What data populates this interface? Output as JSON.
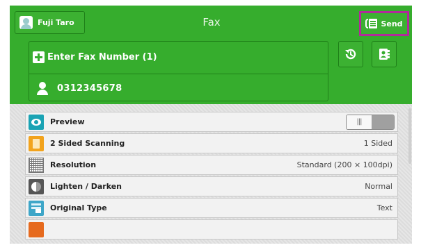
{
  "header": {
    "user_name": "Fuji Taro",
    "title": "Fax",
    "send_label": "Send"
  },
  "fax": {
    "enter_label": "Enter Fax Number (1)",
    "recipient_number": "0312345678"
  },
  "settings": [
    {
      "label": "Preview",
      "value": "",
      "icon": "eye-icon",
      "toggle": "off"
    },
    {
      "label": "2 Sided Scanning",
      "value": "1 Sided",
      "icon": "two-sided-icon"
    },
    {
      "label": "Resolution",
      "value": "Standard (200 × 100dpi)",
      "icon": "resolution-grid-icon"
    },
    {
      "label": "Lighten / Darken",
      "value": "Normal",
      "icon": "contrast-icon"
    },
    {
      "label": "Original Type",
      "value": "Text",
      "icon": "original-type-icon"
    }
  ],
  "colors": {
    "header_green": "#36ad2d",
    "send_highlight": "#b12a9a"
  }
}
